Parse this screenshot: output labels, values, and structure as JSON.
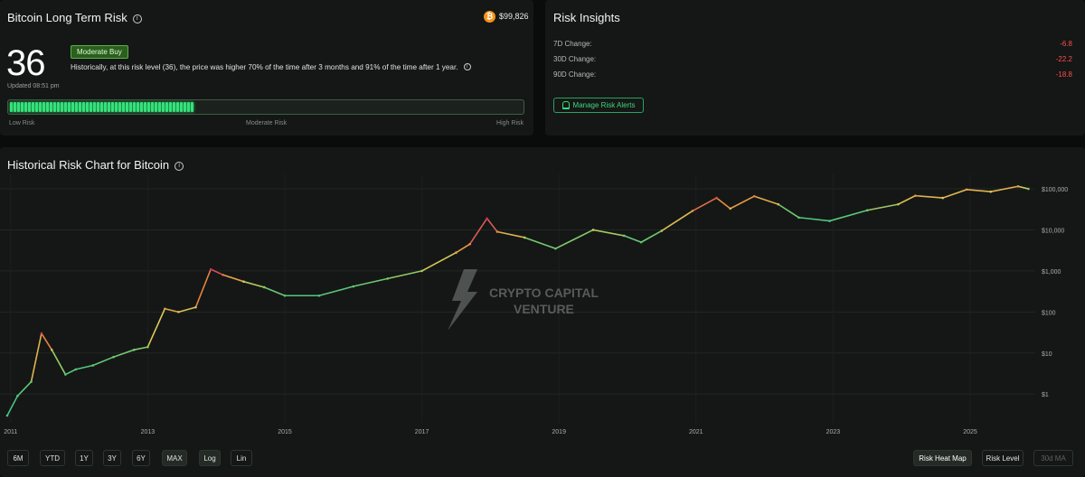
{
  "risk": {
    "title": "Bitcoin Long Term Risk",
    "price": "$99,826",
    "value": "36",
    "tag": "Moderate Buy",
    "description": "Historically, at this risk level (36), the price was higher 70% of the time after 3 months and 91% of the time after 1 year.",
    "updated": "Updated 08:51 pm",
    "meter_fraction": 0.36,
    "meter_labels": {
      "low": "Low Risk",
      "moderate": "Moderate Risk",
      "high": "High Risk"
    }
  },
  "insights": {
    "title": "Risk Insights",
    "rows": [
      {
        "label": "7D Change:",
        "value": "-6.8"
      },
      {
        "label": "30D Change:",
        "value": "-22.2"
      },
      {
        "label": "90D Change:",
        "value": "-18.8"
      }
    ],
    "alerts_button": "Manage Risk Alerts"
  },
  "chart": {
    "title": "Historical Risk Chart for Bitcoin",
    "watermark_line1": "CRYPTO CAPITAL",
    "watermark_line2": "VENTURE",
    "timeframes": [
      "6M",
      "YTD",
      "1Y",
      "3Y",
      "6Y",
      "MAX",
      "Log",
      "Lin"
    ],
    "active_timeframe": "MAX",
    "active_scale": "Log",
    "modes": [
      "Risk Heat Map",
      "Risk Level",
      "30d MA"
    ],
    "active_mode": "Risk Heat Map",
    "disabled_mode": "30d MA"
  },
  "chart_data": {
    "type": "line",
    "title": "Historical Risk Chart for Bitcoin",
    "xlabel": "",
    "ylabel": "",
    "y_scale": "log",
    "ylim": [
      0.2,
      150000
    ],
    "xlim": [
      2010.95,
      2025.95
    ],
    "x_ticks": [
      2011,
      2013,
      2015,
      2017,
      2019,
      2021,
      2023,
      2025
    ],
    "x_tick_labels": [
      "2011",
      "2013",
      "2015",
      "2017",
      "2019",
      "2021",
      "2023",
      "2025"
    ],
    "y_ticks": [
      1,
      10,
      100,
      1000,
      10000,
      100000
    ],
    "y_tick_labels": [
      "$1",
      "$10",
      "$100",
      "$1,000",
      "$10,000",
      "$100,000"
    ],
    "grid": true,
    "color_encoding": "risk heat map (green = low risk, yellow/orange = moderate, red/magenta = high)",
    "points": [
      [
        2010.95,
        0.3,
        0.1
      ],
      [
        2011.1,
        0.9,
        0.15
      ],
      [
        2011.3,
        2.0,
        0.3
      ],
      [
        2011.45,
        30,
        0.95
      ],
      [
        2011.6,
        12,
        0.6
      ],
      [
        2011.8,
        3.0,
        0.2
      ],
      [
        2011.95,
        4.0,
        0.18
      ],
      [
        2012.2,
        5.0,
        0.2
      ],
      [
        2012.5,
        8.0,
        0.3
      ],
      [
        2012.8,
        12,
        0.35
      ],
      [
        2013.0,
        14,
        0.4
      ],
      [
        2013.25,
        120,
        0.7
      ],
      [
        2013.45,
        100,
        0.6
      ],
      [
        2013.7,
        130,
        0.55
      ],
      [
        2013.92,
        1100,
        1.0
      ],
      [
        2014.1,
        800,
        0.8
      ],
      [
        2014.4,
        550,
        0.55
      ],
      [
        2014.7,
        400,
        0.4
      ],
      [
        2015.0,
        250,
        0.2
      ],
      [
        2015.5,
        250,
        0.18
      ],
      [
        2016.0,
        420,
        0.25
      ],
      [
        2016.5,
        650,
        0.35
      ],
      [
        2017.0,
        1000,
        0.45
      ],
      [
        2017.5,
        2800,
        0.65
      ],
      [
        2017.7,
        4500,
        0.75
      ],
      [
        2017.95,
        19000,
        1.0
      ],
      [
        2018.1,
        9000,
        0.75
      ],
      [
        2018.5,
        6500,
        0.5
      ],
      [
        2018.95,
        3500,
        0.2
      ],
      [
        2019.5,
        10000,
        0.55
      ],
      [
        2019.95,
        7200,
        0.35
      ],
      [
        2020.2,
        5000,
        0.2
      ],
      [
        2020.5,
        9500,
        0.45
      ],
      [
        2020.95,
        29000,
        0.75
      ],
      [
        2021.3,
        60000,
        0.9
      ],
      [
        2021.5,
        33000,
        0.6
      ],
      [
        2021.85,
        66000,
        0.8
      ],
      [
        2022.2,
        42000,
        0.5
      ],
      [
        2022.5,
        20000,
        0.2
      ],
      [
        2022.95,
        16500,
        0.1
      ],
      [
        2023.5,
        30000,
        0.35
      ],
      [
        2023.95,
        42000,
        0.5
      ],
      [
        2024.2,
        68000,
        0.7
      ],
      [
        2024.6,
        60000,
        0.55
      ],
      [
        2024.95,
        96000,
        0.7
      ],
      [
        2025.3,
        85000,
        0.55
      ],
      [
        2025.7,
        115000,
        0.7
      ],
      [
        2025.85,
        99826,
        0.36
      ]
    ]
  }
}
